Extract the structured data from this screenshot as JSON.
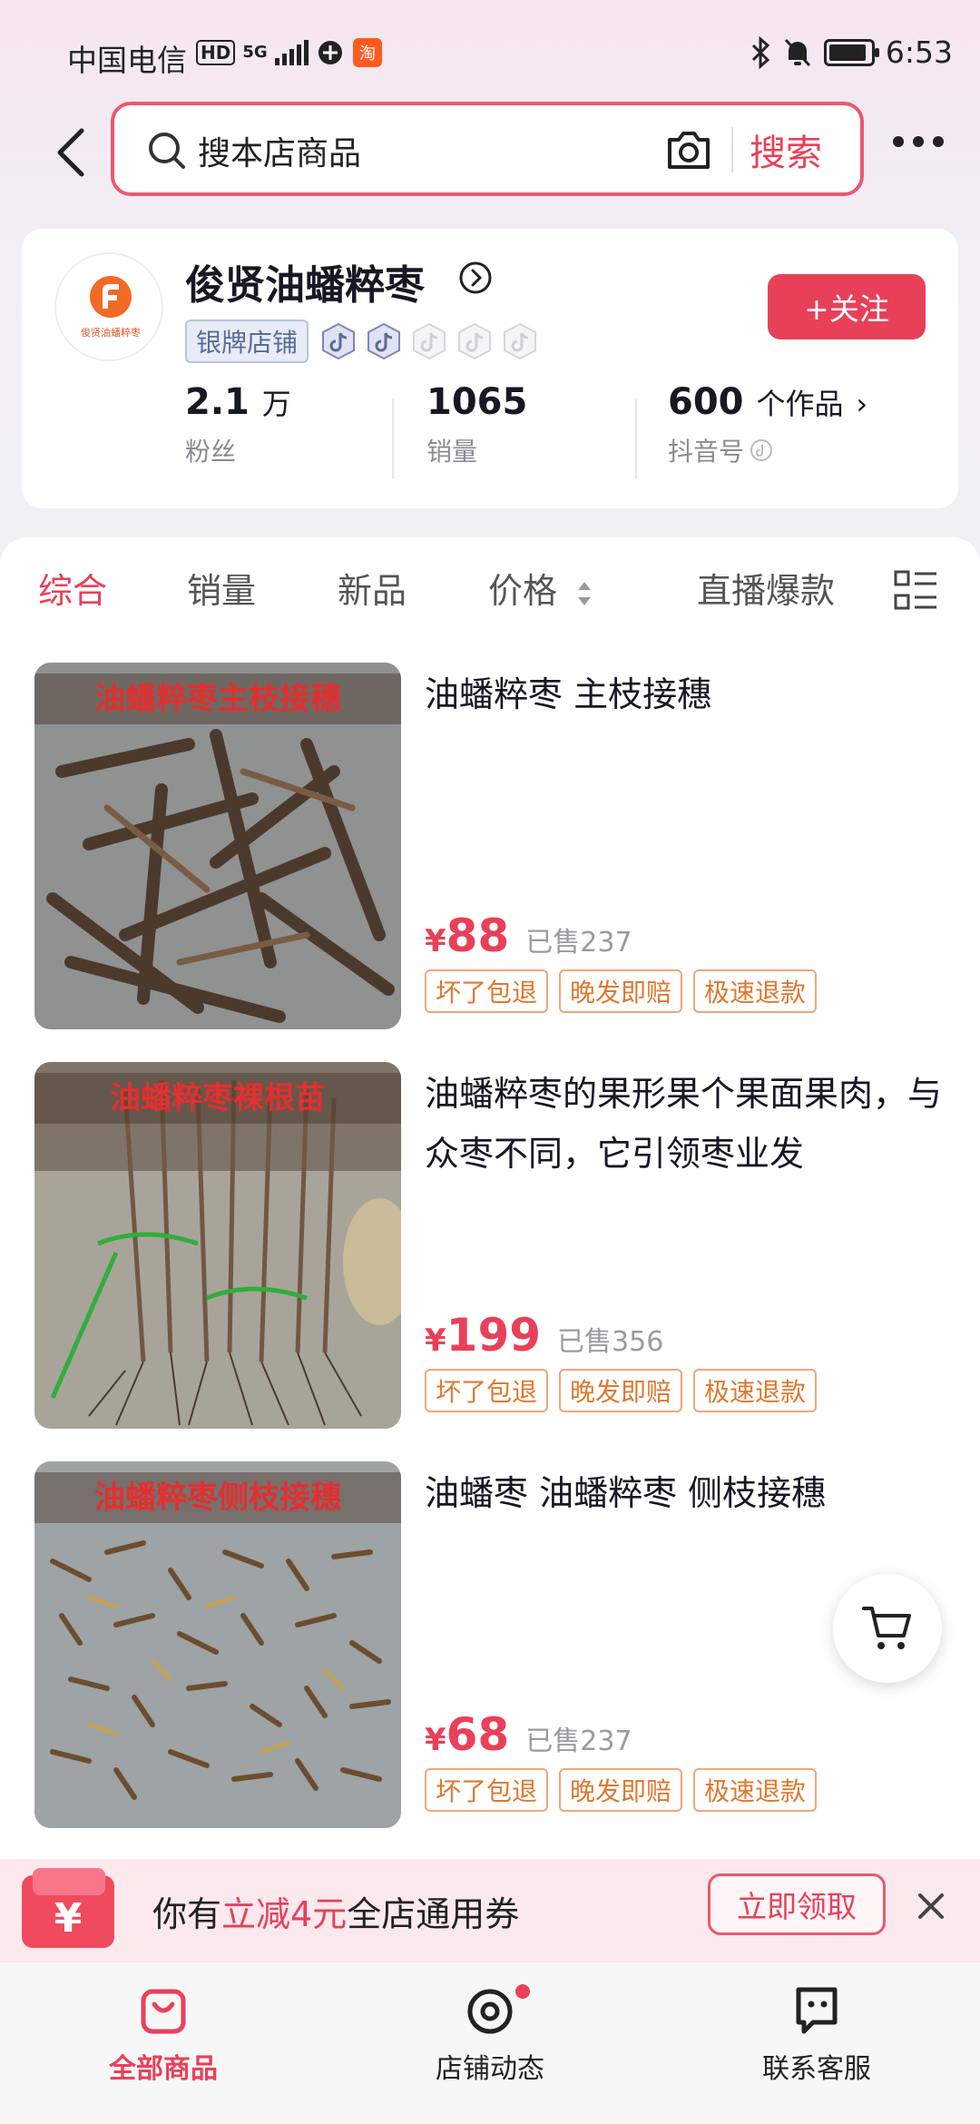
{
  "status_bar": {
    "carrier": "中国电信",
    "hd": "HD",
    "network": "5G",
    "time": "6:53"
  },
  "search": {
    "placeholder": "搜本店商品",
    "button": "搜索"
  },
  "shop": {
    "name": "俊贤油蟠粹枣",
    "logo_caption": "俊贤油蟠粹枣",
    "badge": "银牌店铺",
    "follow_label": "+关注",
    "stats": {
      "fans_value": "2.1",
      "fans_unit": "万",
      "fans_label": "粉丝",
      "sales_value": "1065",
      "sales_label": "销量",
      "works_value": "600",
      "works_unit": "个作品",
      "works_label": "抖音号"
    }
  },
  "tabs": {
    "comprehensive": "综合",
    "sales": "销量",
    "new": "新品",
    "price": "价格",
    "live_hot": "直播爆款"
  },
  "products": [
    {
      "image_caption": "油蟠粹枣主枝接穗",
      "title": "油蟠粹枣 主枝接穗",
      "currency": "¥",
      "price": "88",
      "sold": "已售237",
      "tags": [
        "坏了包退",
        "晚发即赔",
        "极速退款"
      ]
    },
    {
      "image_caption": "油蟠粹枣裸根苗",
      "title": "油蟠粹枣的果形果个果面果肉，与众枣不同，它引领枣业发",
      "currency": "¥",
      "price": "199",
      "sold": "已售356",
      "tags": [
        "坏了包退",
        "晚发即赔",
        "极速退款"
      ]
    },
    {
      "image_caption": "油蟠粹枣侧枝接穗",
      "title": "油蟠枣 油蟠粹枣 侧枝接穗",
      "currency": "¥",
      "price": "68",
      "sold": "已售237",
      "tags": [
        "坏了包退",
        "晚发即赔",
        "极速退款"
      ]
    }
  ],
  "coupon": {
    "icon_symbol": "¥",
    "prefix": "你有",
    "highlight": "立减4元",
    "suffix": "全店通用券",
    "claim": "立即领取"
  },
  "bottom_nav": {
    "all_products": "全部商品",
    "shop_updates": "店铺动态",
    "contact": "联系客服"
  },
  "colors": {
    "accent": "#e9405a",
    "tag_orange": "#e0782f",
    "badge_blue": "#5a6b94"
  }
}
